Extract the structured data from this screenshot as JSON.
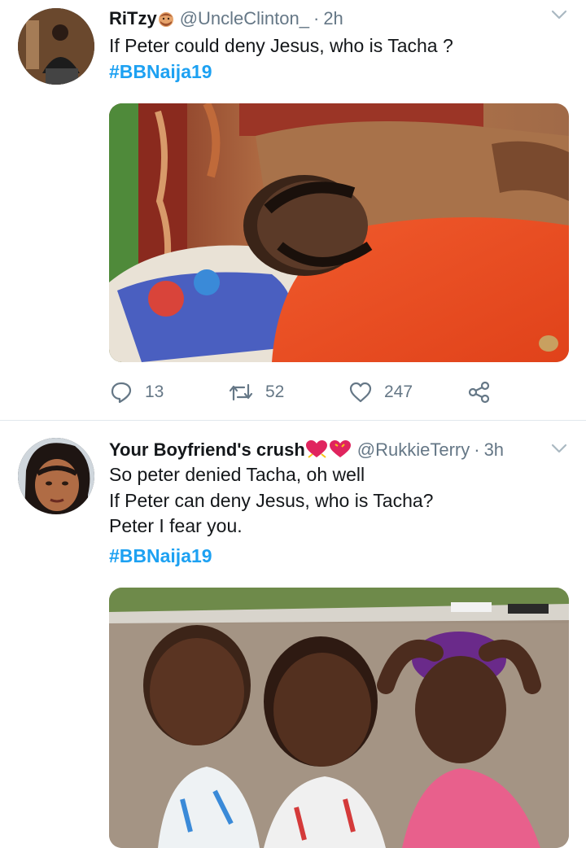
{
  "tweets": [
    {
      "display_name": "RiTzy",
      "name_emoji": "man-emoji-icon",
      "handle": "@UncleClinton_",
      "separator": "·",
      "time": "2h",
      "text_lines": "If Peter could deny Jesus, who is Tacha ?",
      "hashtag": "#BBNaija19",
      "media_description": "photo-man-lying-on-pillow",
      "stats": {
        "replies": "13",
        "retweets": "52",
        "likes": "247"
      }
    },
    {
      "display_name": "Your Boyfriend's crush",
      "name_emoji": "hearts-emoji-icon",
      "handle": "@RukkieTerry",
      "separator": "·",
      "time": "3h",
      "text_lines": "So peter denied Tacha, oh well\nIf Peter can deny Jesus, who is Tacha?\nPeter I fear you.",
      "hashtag": "#BBNaija19",
      "media_description": "photo-three-toddlers"
    }
  ],
  "colors": {
    "link": "#1da1f2",
    "muted": "#657786",
    "text": "#14171a",
    "divider": "#e1e8ed"
  }
}
